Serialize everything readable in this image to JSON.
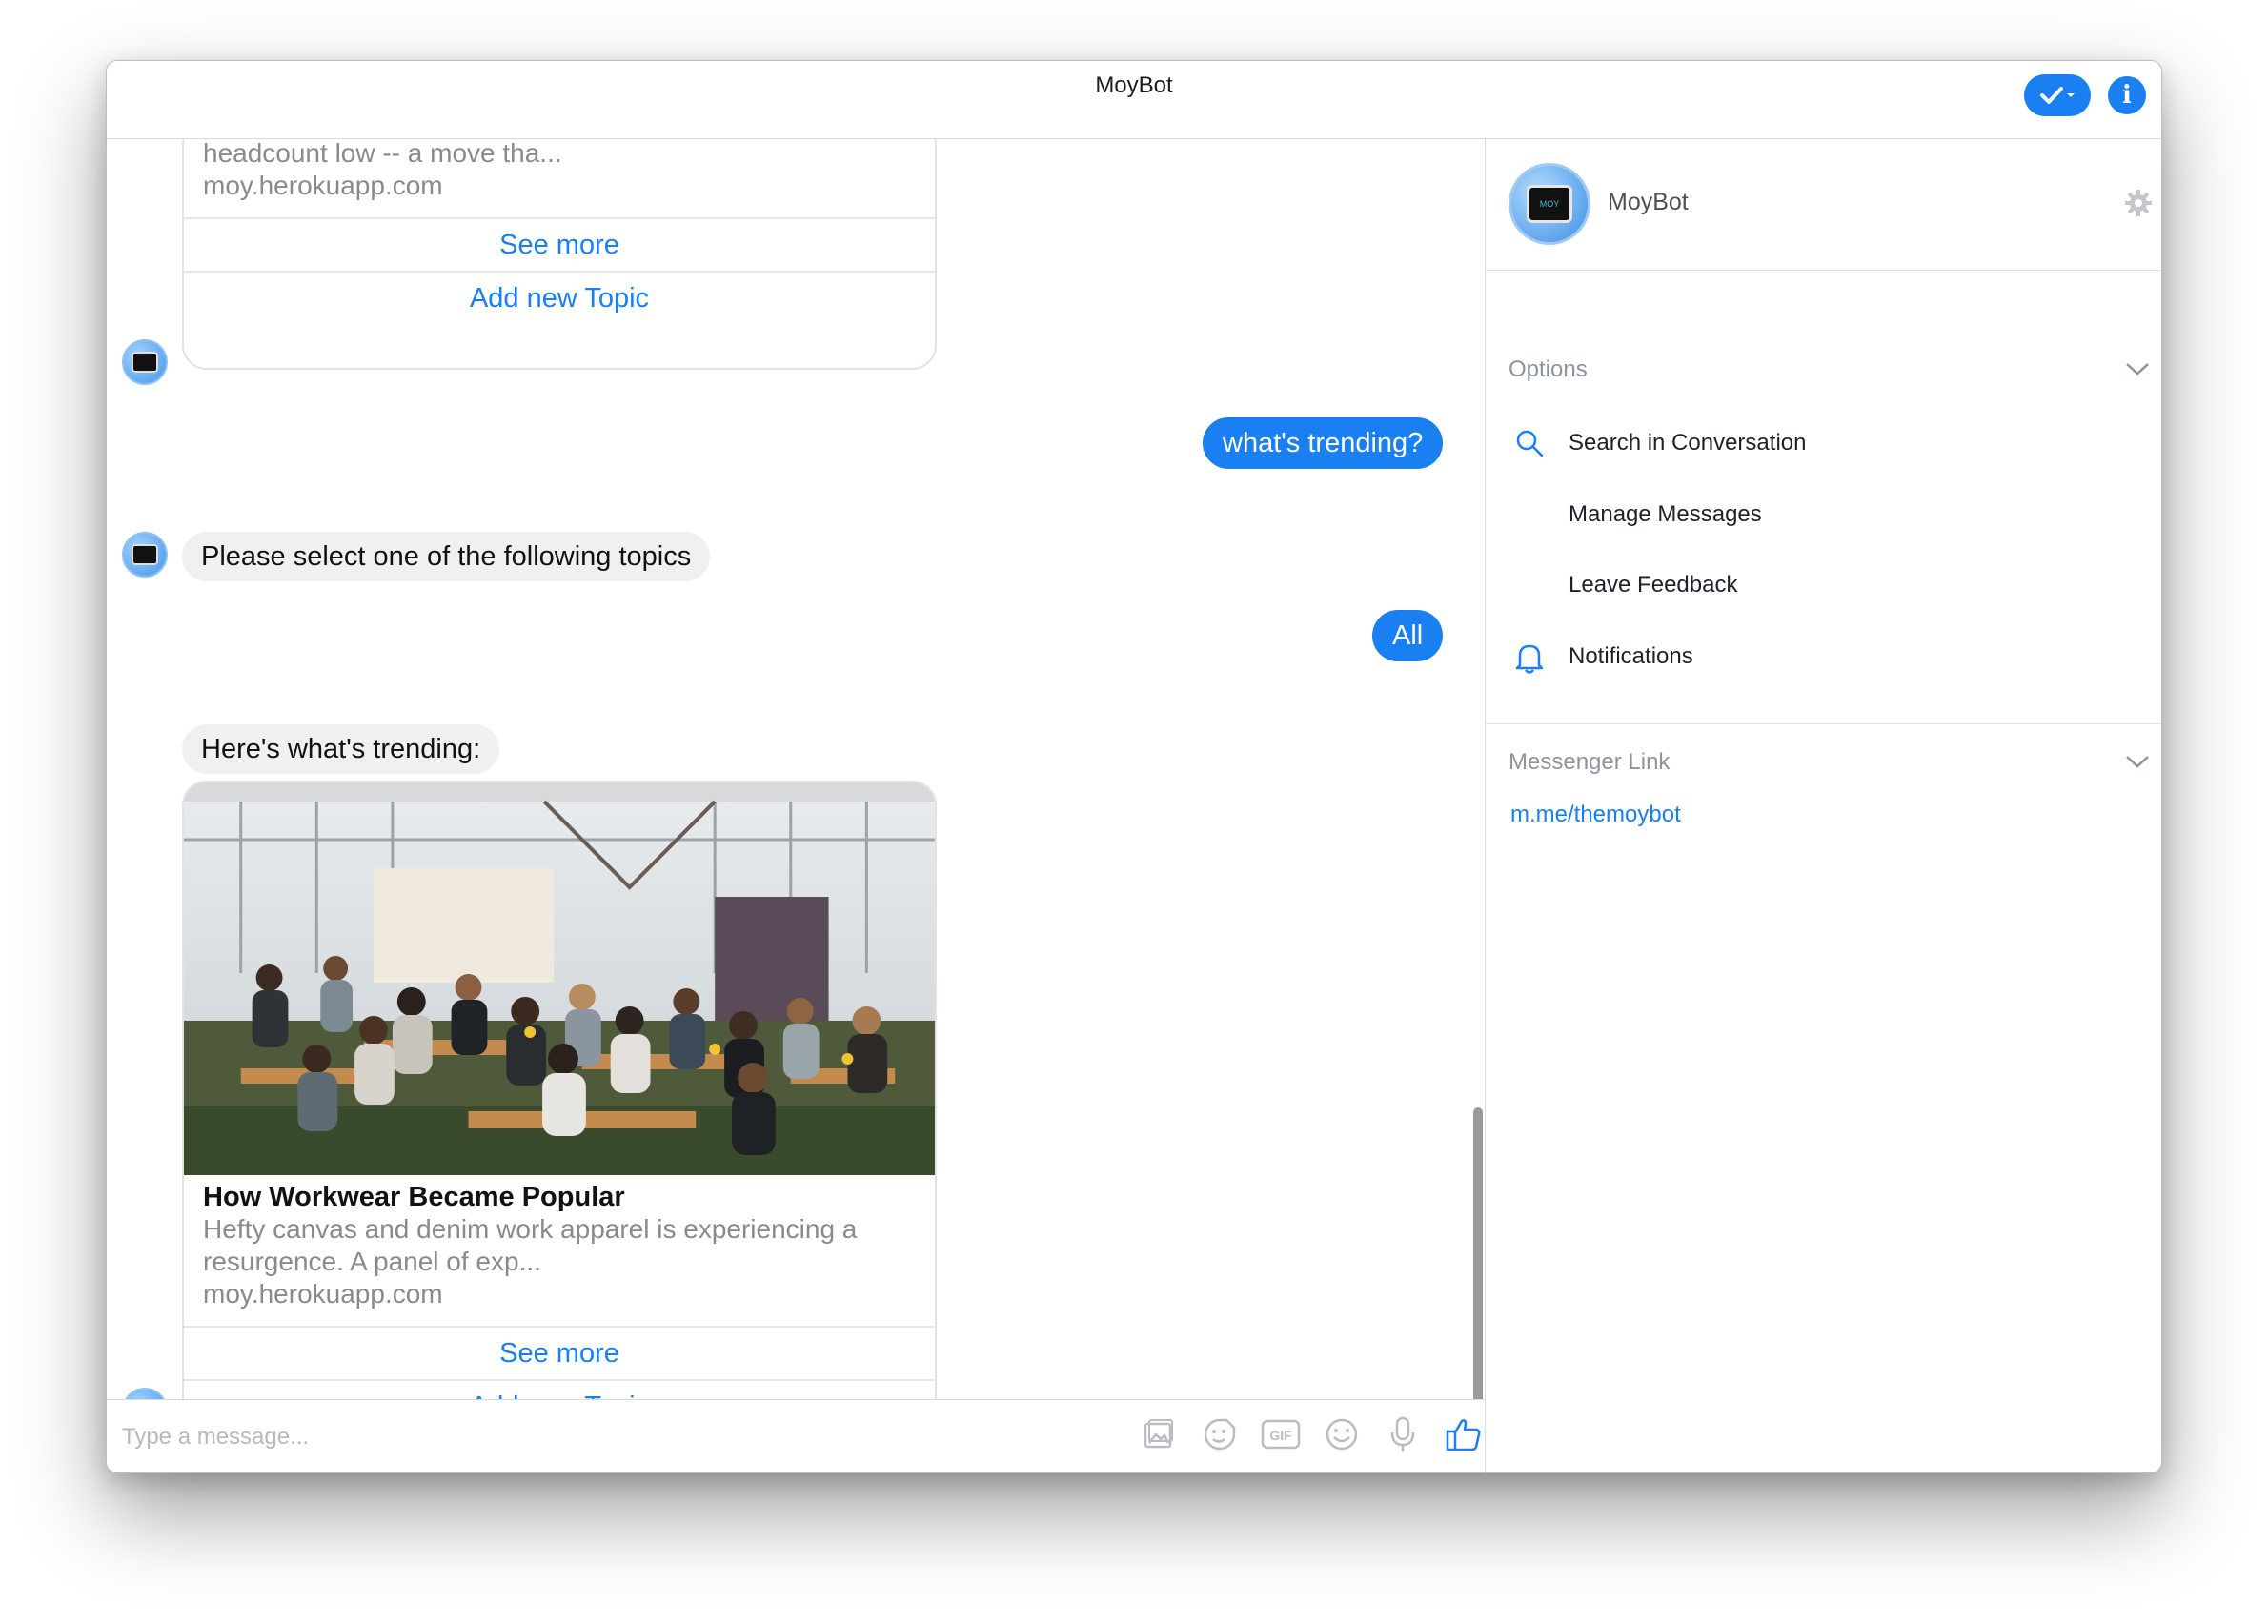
{
  "window": {
    "title": "MoyBot"
  },
  "chat": {
    "top_card": {
      "description_tail": "headcount low -- a move tha...",
      "domain": "moy.herokuapp.com",
      "buttons": [
        "See more",
        "Add new Topic"
      ]
    },
    "msg_user_1": "what's trending?",
    "msg_bot_1": "Please select one of the following topics",
    "msg_user_2": "All",
    "msg_bot_2": "Here's what's trending:",
    "bottom_card": {
      "title": "How Workwear Became Popular",
      "description": "Hefty canvas and denim work apparel is experiencing a resurgence. A panel of exp...",
      "description_line1": "Hefty canvas and denim work apparel is experiencing a",
      "description_line2": "resurgence. A panel of exp...",
      "domain": "moy.herokuapp.com",
      "buttons": [
        "See more",
        "Add new Topic"
      ]
    },
    "composer": {
      "placeholder": "Type a message...",
      "icons": [
        "image-icon",
        "sticker-icon",
        "gif-icon",
        "emoji-icon",
        "microphone-icon",
        "like-icon"
      ],
      "gif_label": "GIF"
    }
  },
  "sidebar": {
    "profile_name": "MoyBot",
    "avatar_text": "MOY",
    "options_label": "Options",
    "options": [
      {
        "label": "Search in Conversation",
        "icon": "search-icon"
      },
      {
        "label": "Manage Messages",
        "icon": ""
      },
      {
        "label": "Leave Feedback",
        "icon": ""
      },
      {
        "label": "Notifications",
        "icon": "bell-icon"
      }
    ],
    "messenger_link_label": "Messenger Link",
    "messenger_link": "m.me/themoybot"
  },
  "colors": {
    "accent": "#1a7ff0",
    "bubble_in": "#f1f0f0",
    "muted_text": "#8a8a8a"
  }
}
